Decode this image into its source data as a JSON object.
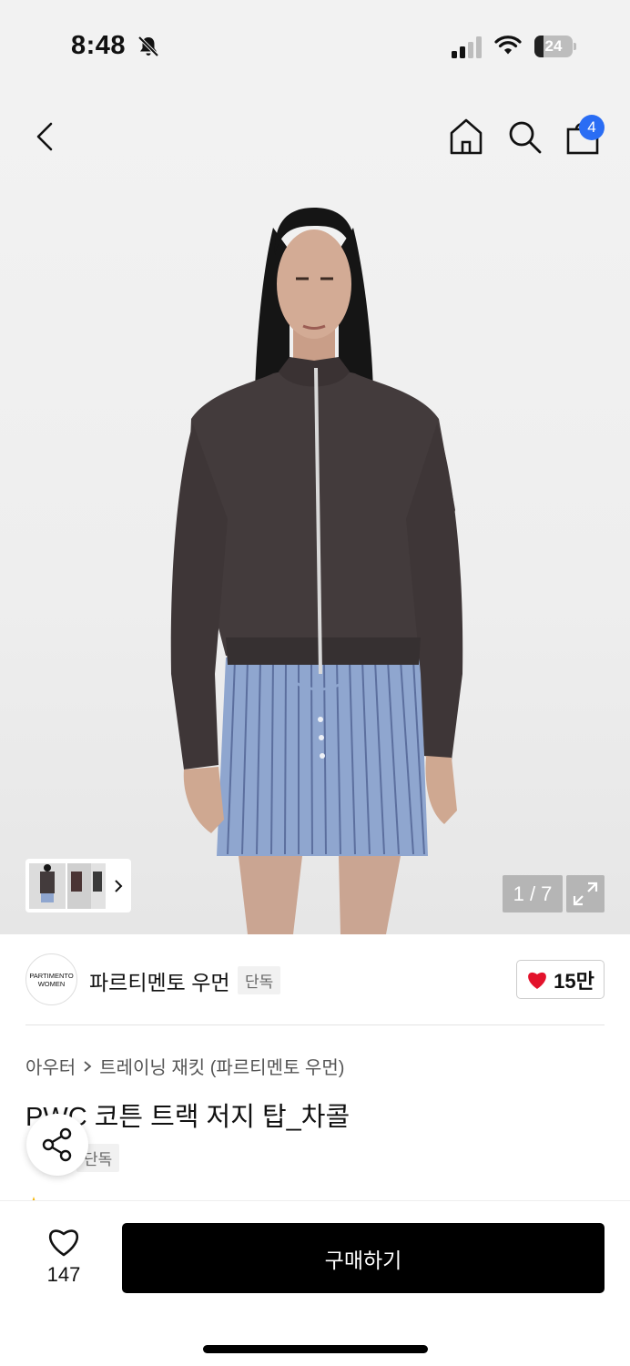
{
  "status": {
    "time": "8:48",
    "battery": "24",
    "battery_level": 0.24
  },
  "nav": {
    "cart_count": "4"
  },
  "gallery": {
    "counter": "1 / 7"
  },
  "brand": {
    "logo_line1": "PARTIMENTO",
    "logo_line2": "WOMEN",
    "name": "파르티멘토 우먼",
    "exclusive_tag": "단독",
    "likes": "15만"
  },
  "breadcrumb": {
    "category": "아우터",
    "subcategory": "트레이닝 재킷 (파르티멘토 우먼)"
  },
  "product": {
    "title": "PWC 코튼 트랙 저지 탑_차콜",
    "exclusive_tag": "단독"
  },
  "bottom": {
    "wish_count": "147",
    "buy_label": "구매하기"
  },
  "colors": {
    "badge": "#2a6df4",
    "heart": "#e3122b",
    "buy_button": "#000000"
  }
}
